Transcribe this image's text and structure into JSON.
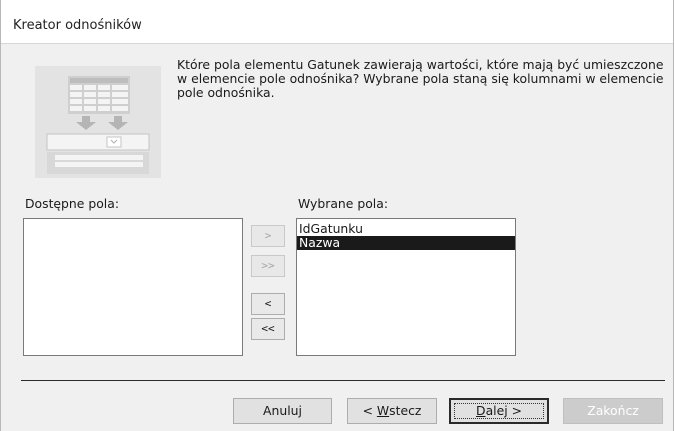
{
  "window": {
    "title": "Kreator odnośników"
  },
  "instructions": "Które pola elementu Gatunek zawierają wartości, które mają być umieszczone w elemencie pole odnośnika? Wybrane pola staną się kolumnami w elemencie pole odnośnika.",
  "available_fields": {
    "label": "Dostępne pola:",
    "items": []
  },
  "selected_fields": {
    "label": "Wybrane pola:",
    "items": [
      {
        "label": "IdGatunku",
        "selected": false
      },
      {
        "label": "Nazwa",
        "selected": true
      }
    ]
  },
  "move_buttons": {
    "add_one": {
      "label": ">",
      "enabled": false
    },
    "add_all": {
      "label": ">>",
      "enabled": false
    },
    "remove_one": {
      "label": "<",
      "enabled": true
    },
    "remove_all": {
      "label": "<<",
      "enabled": true
    }
  },
  "footer": {
    "cancel": {
      "label": "Anuluj"
    },
    "back": {
      "label": "< Wstecz",
      "prefix": "< ",
      "accel": "W",
      "rest": "stecz"
    },
    "next": {
      "label": "Dalej >",
      "accel": "D",
      "rest": "alej >"
    },
    "finish": {
      "label": "Zakończ",
      "enabled": false
    }
  }
}
